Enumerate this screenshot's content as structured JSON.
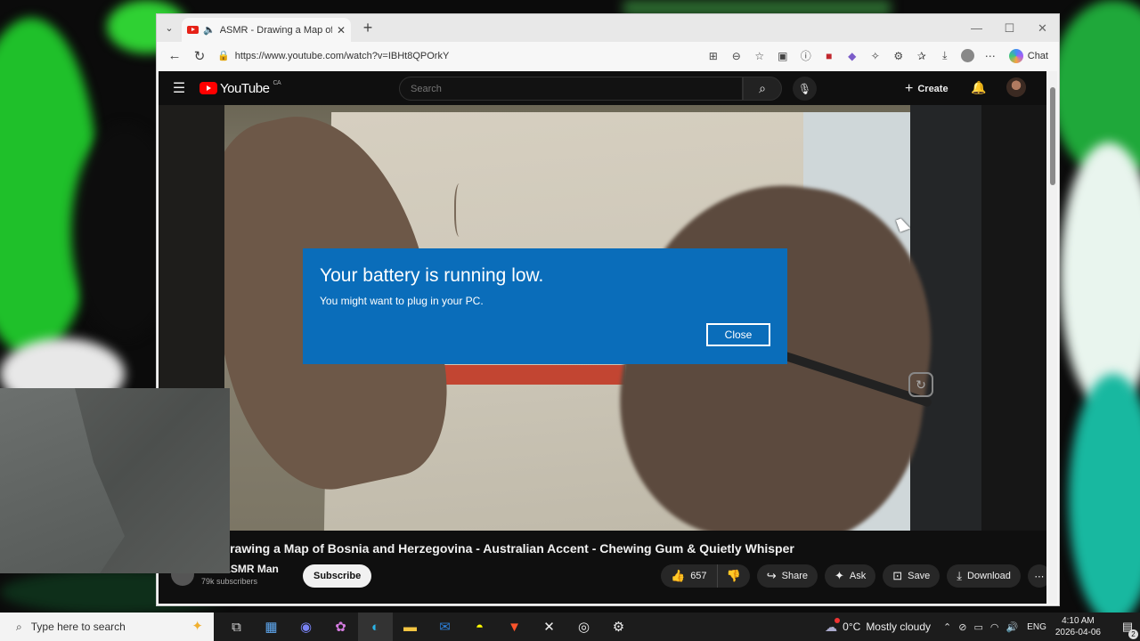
{
  "browser": {
    "tab": {
      "title": "ASMR - Drawing a Map of Bosnia and Herzegovina"
    },
    "address": {
      "url": "https://www.youtube.com/watch?v=IBHt8QPOrkY"
    },
    "chat_label": "Chat",
    "window_controls": {
      "minimize": "—",
      "maximize": "☐",
      "close": "✕"
    }
  },
  "youtube": {
    "logo_text": "YouTube",
    "region": "CA",
    "search_placeholder": "Search",
    "create_label": "Create",
    "video_title": "Drawing a Map of Bosnia and Herzegovina - Australian Accent - Chewing Gum & Quietly Whisper",
    "channel_name": "The ASMR Man",
    "subscribers": "79k subscribers",
    "subscribe_label": "Subscribe",
    "actions": {
      "like_count": "657",
      "share": "Share",
      "ask": "Ask",
      "save": "Save",
      "download": "Download"
    }
  },
  "notification": {
    "title": "Your battery is running low.",
    "message": "You might want to plug in your PC.",
    "close_label": "Close",
    "bg_color": "#0a6dba"
  },
  "taskbar": {
    "search_placeholder": "Type here to search",
    "weather": {
      "temp": "0°C",
      "condition": "Mostly cloudy"
    },
    "language": "ENG",
    "time": "4:10 AM",
    "date": "2026-04-06",
    "notification_count": "2"
  }
}
